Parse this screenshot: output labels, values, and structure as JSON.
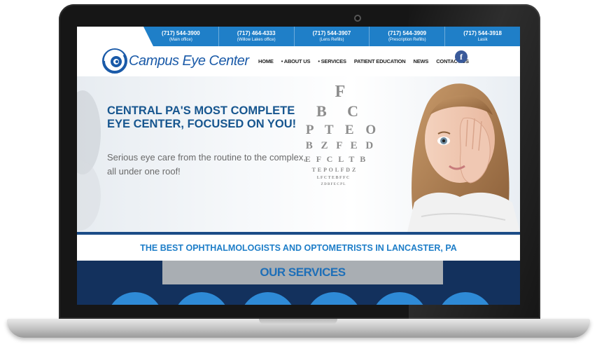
{
  "phones": [
    {
      "number": "(717) 544-3900",
      "label": "(Main office)"
    },
    {
      "number": "(717) 464-4333",
      "label": "(Willow Lakes office)"
    },
    {
      "number": "(717) 544-3907",
      "label": "(Lens Refills)"
    },
    {
      "number": "(717) 544-3909",
      "label": "(Prescription Refills)"
    },
    {
      "number": "(717) 544-3918",
      "label": "Lasik"
    }
  ],
  "logo": {
    "text": "Campus Eye Center"
  },
  "nav": [
    "HOME",
    "• ABOUT US",
    "• SERVICES",
    "PATIENT EDUCATION",
    "NEWS",
    "CONTACT US"
  ],
  "facebook": {
    "icon": "facebook-icon",
    "glyph": "f"
  },
  "hero": {
    "title": "CENTRAL PA'S MOST COMPLETE EYE CENTER, FOCUSED ON YOU!",
    "subtitle": "Serious eye care from the routine to the complex, all under one roof!"
  },
  "eye_chart": [
    "F",
    "B C",
    "P T E O",
    "B Z F E D",
    "E F C L T B",
    "T E P O L F D Z",
    "L F C T E B F F C",
    "Z D B F E C P L"
  ],
  "tagline": "THE BEST OPHTHALMOLOGISTS AND OPTOMETRISTS IN LANCASTER, PA",
  "services": {
    "title": "OUR SERVICES"
  },
  "colors": {
    "brand_blue": "#1f7fc8",
    "navy": "#13315d",
    "title_blue": "#17568f"
  }
}
